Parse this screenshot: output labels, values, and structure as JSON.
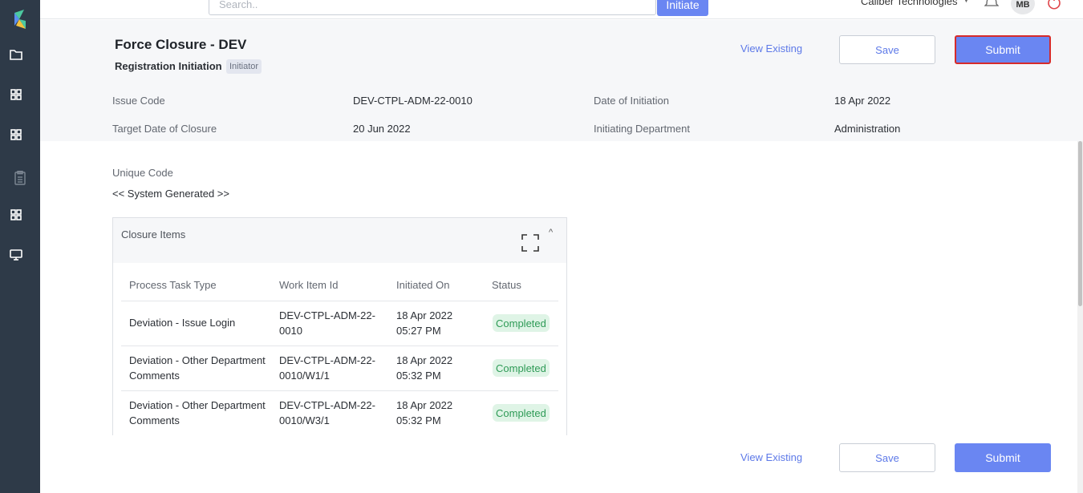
{
  "topbar": {
    "search_placeholder": "Search..",
    "initiate_label": "Initiate",
    "org_name": "Caliber Technologies",
    "avatar_initials": "MB"
  },
  "header": {
    "title": "Force Closure - DEV",
    "subtitle": "Registration Initiation",
    "role_badge": "Initiator",
    "view_existing_label": "View Existing",
    "save_label": "Save",
    "submit_label": "Submit"
  },
  "meta": {
    "issue_code_label": "Issue Code",
    "issue_code_value": "DEV-CTPL-ADM-22-0010",
    "date_of_initiation_label": "Date of Initiation",
    "date_of_initiation_value": "18 Apr 2022",
    "target_date_label": "Target Date of Closure",
    "target_date_value": "20 Jun 2022",
    "initiating_dept_label": "Initiating Department",
    "initiating_dept_value": "Administration"
  },
  "unique_code": {
    "label": "Unique Code",
    "value": "<< System Generated >>"
  },
  "closure_items": {
    "title": "Closure Items",
    "columns": [
      "Process Task Type",
      "Work Item Id",
      "Initiated On",
      "Status"
    ],
    "rows": [
      {
        "task_type_1": "Deviation - Issue Login",
        "task_type_2": "",
        "work_item_1": "DEV-CTPL-ADM-22-",
        "work_item_2": "0010",
        "initiated_1": "18 Apr 2022",
        "initiated_2": "05:27 PM",
        "status": "Completed"
      },
      {
        "task_type_1": "Deviation - Other Department",
        "task_type_2": "Comments",
        "work_item_1": "DEV-CTPL-ADM-22-",
        "work_item_2": "0010/W1/1",
        "initiated_1": "18 Apr 2022",
        "initiated_2": "05:32 PM",
        "status": "Completed"
      },
      {
        "task_type_1": "Deviation - Other Department",
        "task_type_2": "Comments",
        "work_item_1": "DEV-CTPL-ADM-22-",
        "work_item_2": "0010/W3/1",
        "initiated_1": "18 Apr 2022",
        "initiated_2": "05:32 PM",
        "status": "Completed"
      }
    ]
  },
  "footer": {
    "view_existing_label": "View Existing",
    "save_label": "Save",
    "submit_label": "Submit"
  },
  "colors": {
    "sidebar_bg": "#2e3a48",
    "accent": "#6a86f2",
    "status_green": "#2f9b57"
  }
}
